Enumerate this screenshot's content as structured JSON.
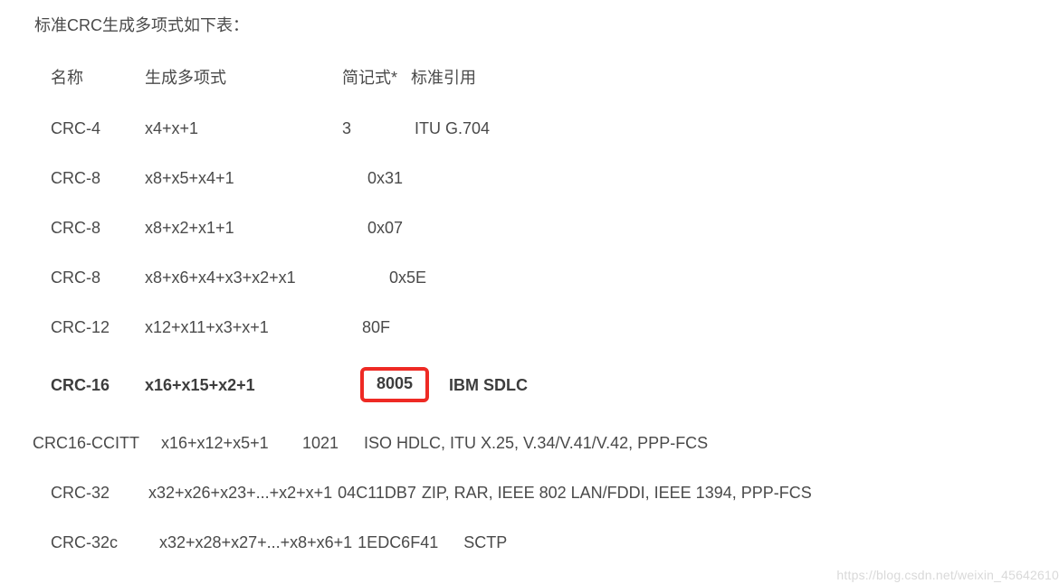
{
  "title": "标准CRC生成多项式如下表：",
  "headers": {
    "name": "名称",
    "polynomial": "生成多项式",
    "shorthand": "简记式*",
    "reference": "标准引用"
  },
  "rows": [
    {
      "name": "CRC-4",
      "poly": "x4+x+1",
      "short": "3",
      "ref": "ITU G.704"
    },
    {
      "name": "CRC-8",
      "poly": "x8+x5+x4+1",
      "short": "0x31",
      "ref": ""
    },
    {
      "name": "CRC-8",
      "poly": "x8+x2+x1+1",
      "short": "0x07",
      "ref": ""
    },
    {
      "name": "CRC-8",
      "poly": "x8+x6+x4+x3+x2+x1",
      "short": "0x5E",
      "ref": ""
    },
    {
      "name": "CRC-12",
      "poly": "x12+x11+x3+x+1",
      "short": "80F",
      "ref": ""
    },
    {
      "name": "CRC-16",
      "poly": "x16+x15+x2+1",
      "short": "8005",
      "ref": "IBM SDLC",
      "bold": true,
      "highlight_short": true
    },
    {
      "name": "CRC16-CCITT",
      "poly": "x16+x12+x5+1",
      "short": "1021",
      "ref": "ISO HDLC, ITU X.25, V.34/V.41/V.42, PPP-FCS",
      "noindent": true
    },
    {
      "name": "CRC-32",
      "poly": "x32+x26+x23+...+x2+x+1",
      "short": "04C11DB7",
      "ref": "ZIP, RAR, IEEE 802 LAN/FDDI, IEEE 1394, PPP-FCS",
      "long": true
    },
    {
      "name": "CRC-32c",
      "poly": "x32+x28+x27+...+x8+x6+1",
      "short": "1EDC6F41",
      "ref": "SCTP",
      "long": true,
      "variant_c": true
    }
  ],
  "watermark": "https://blog.csdn.net/weixin_45642610"
}
